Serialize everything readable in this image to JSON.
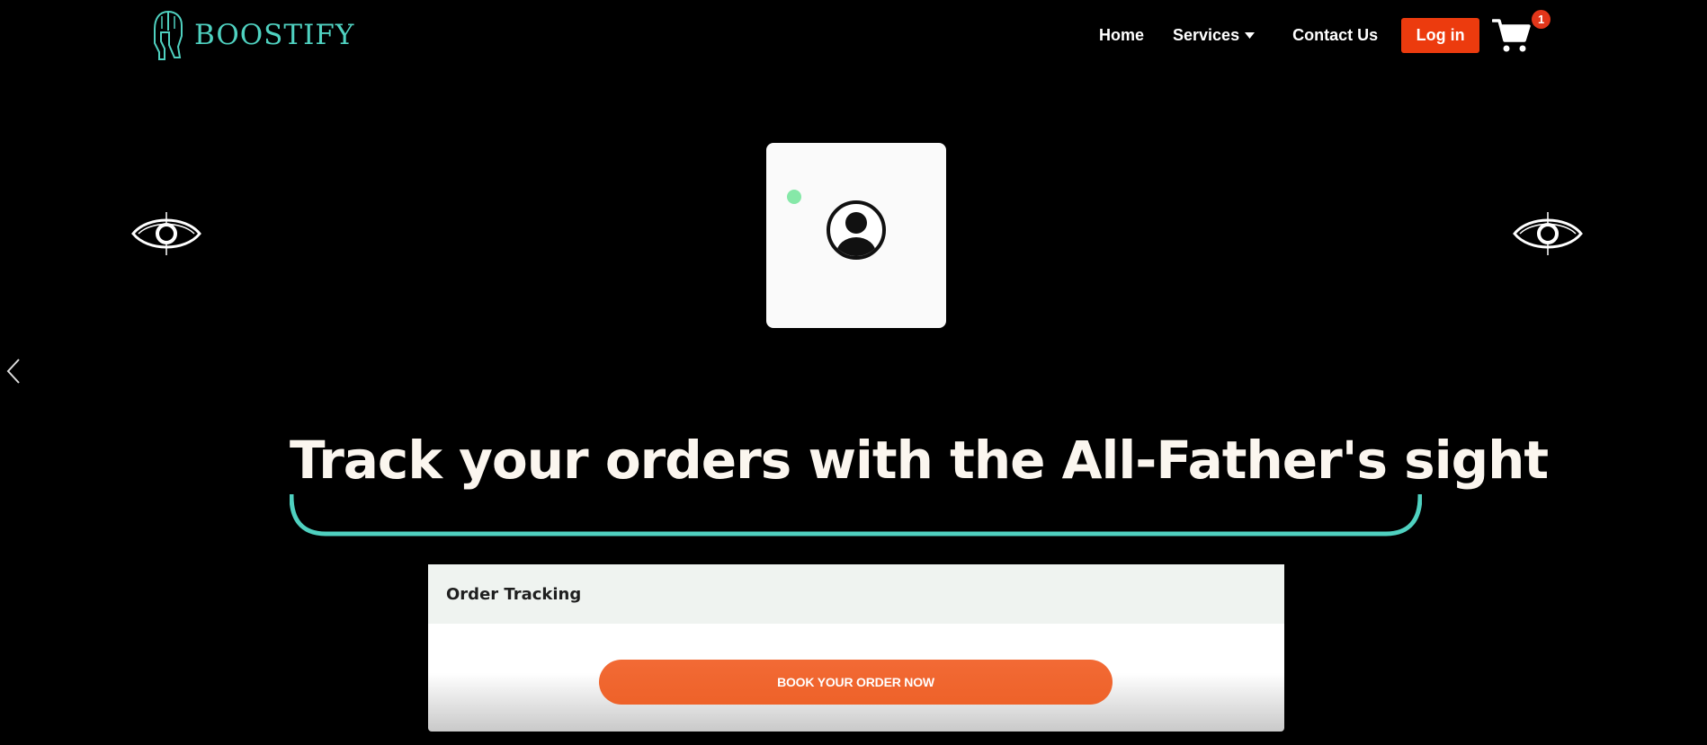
{
  "brand": {
    "name": "BOOSTIFY",
    "logo_icon": "spartan-helmet-icon",
    "color": "#4fd1c0"
  },
  "nav": {
    "home": "Home",
    "services": "Services",
    "contact": "Contact Us",
    "login": "Log in",
    "cart_count": "1",
    "login_color": "#ec3b0e"
  },
  "hero": {
    "headline": "Track your orders with the All-Father's sight",
    "eye_icon": "eye-crosshair-icon",
    "avatar_icon": "user-avatar-icon",
    "status_color": "#86e8a8",
    "accent_underline": "#4fd1c0"
  },
  "order_tracking": {
    "title": "Order Tracking",
    "button_label": "BOOK YOUR ORDER NOW",
    "button_color": "#f26a35"
  }
}
